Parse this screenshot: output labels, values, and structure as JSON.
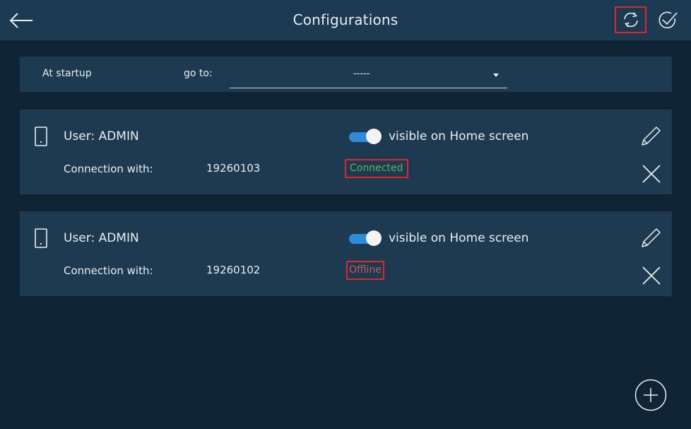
{
  "header": {
    "title": "Configurations",
    "back_icon": "arrow-left-icon",
    "sync_icon": "sync-icon",
    "confirm_icon": "check-circle-icon"
  },
  "startup": {
    "label": "At startup",
    "goto_label": "go to:",
    "selected_value": "-----"
  },
  "configurations": [
    {
      "user_label": "User: ADMIN",
      "visible_label": "visible on Home screen",
      "visible_on": true,
      "connection_label": "Connection with:",
      "connection_id": "19260103",
      "status": "Connected"
    },
    {
      "user_label": "User: ADMIN",
      "visible_label": "visible on Home screen",
      "visible_on": true,
      "connection_label": "Connection with:",
      "connection_id": "19260102",
      "status": "Offline"
    }
  ],
  "colors": {
    "background": "#0f2536",
    "panel": "#1d3a50",
    "accent": "#2e8bd8",
    "connected": "#5cb65c",
    "offline": "#c45a5a",
    "highlight": "#e0252f"
  }
}
